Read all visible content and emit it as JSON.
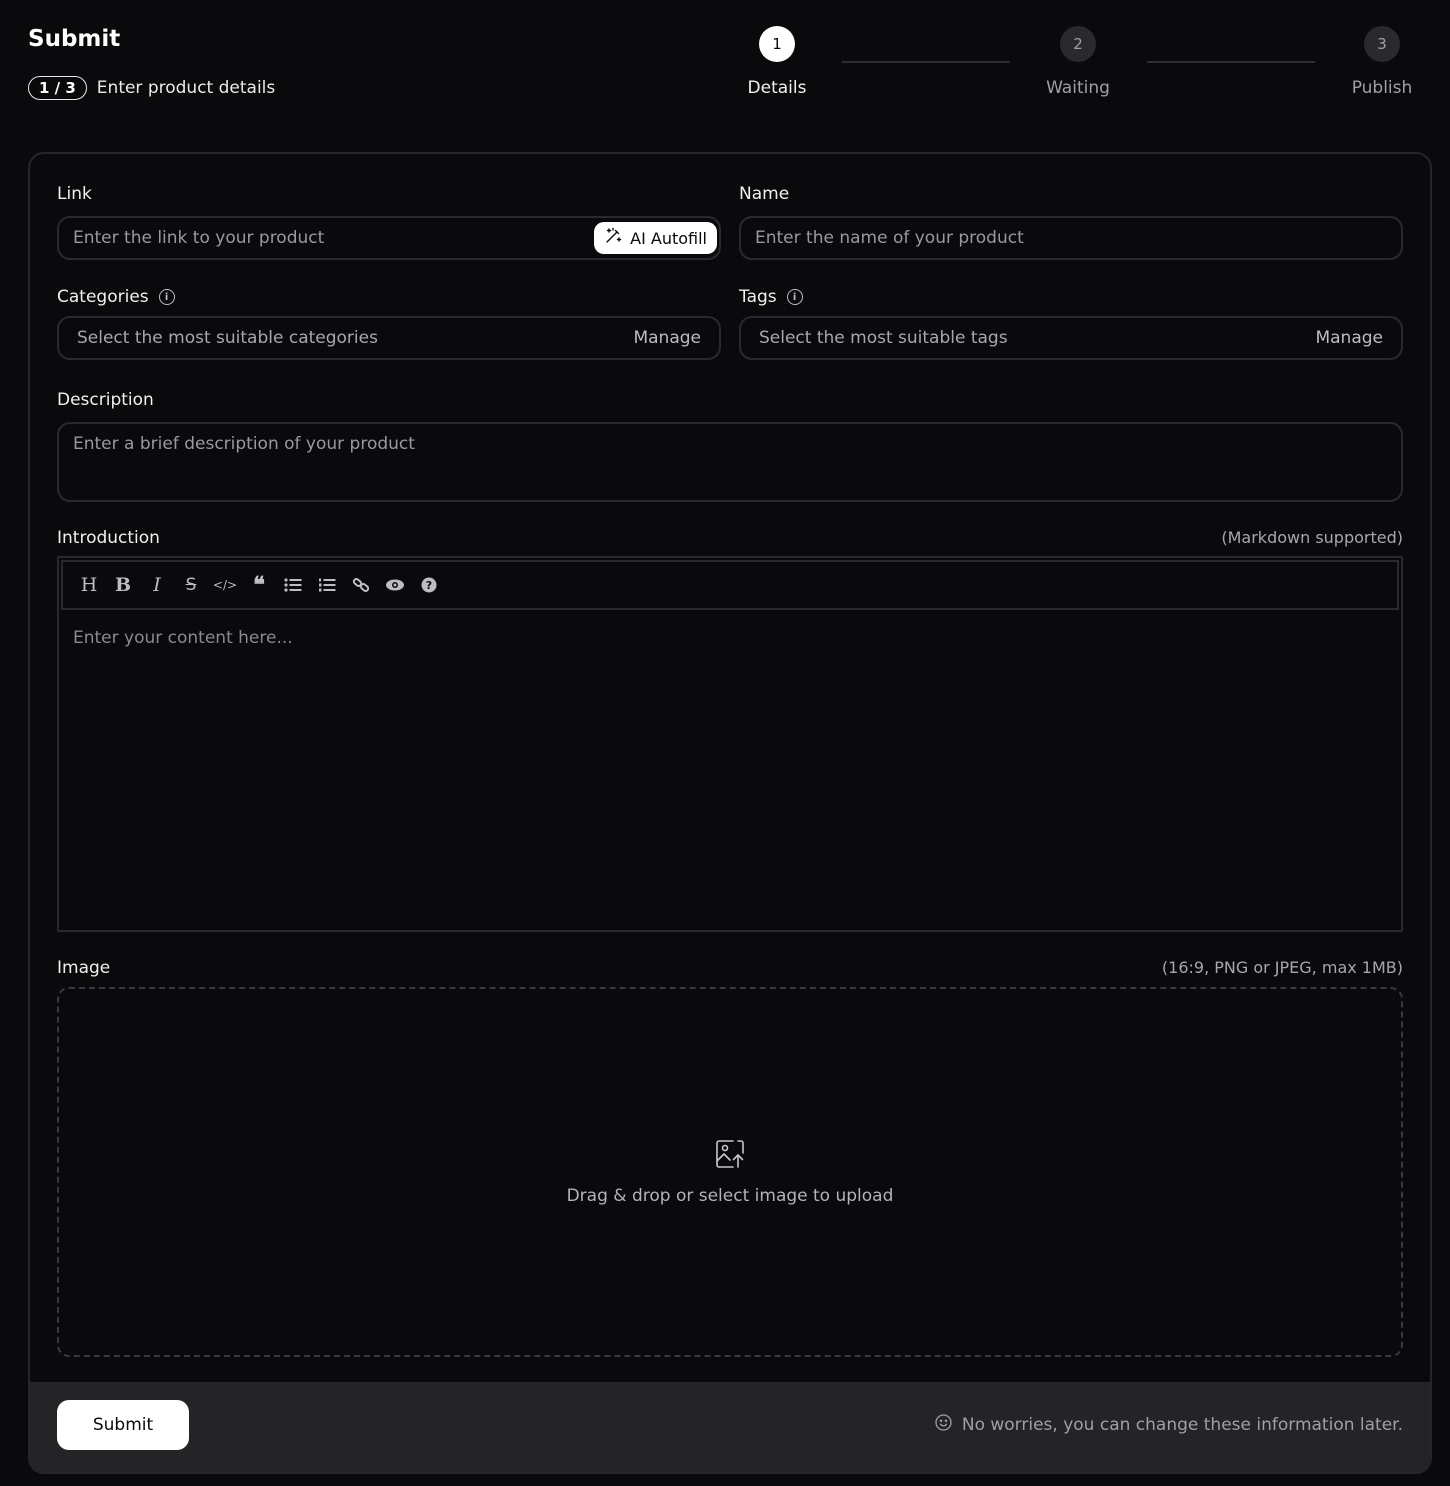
{
  "header": {
    "title": "Submit",
    "step_badge": "1 / 3",
    "step_description": "Enter product details"
  },
  "stepper": {
    "steps": [
      {
        "number": "1",
        "label": "Details",
        "active": true
      },
      {
        "number": "2",
        "label": "Waiting",
        "active": false
      },
      {
        "number": "3",
        "label": "Publish",
        "active": false
      }
    ]
  },
  "form": {
    "link": {
      "label": "Link",
      "placeholder": "Enter the link to your product",
      "autofill_label": "AI Autofill"
    },
    "name": {
      "label": "Name",
      "placeholder": "Enter the name of your product"
    },
    "categories": {
      "label": "Categories",
      "placeholder": "Select the most suitable categories",
      "manage_label": "Manage"
    },
    "tags": {
      "label": "Tags",
      "placeholder": "Select the most suitable tags",
      "manage_label": "Manage"
    },
    "description": {
      "label": "Description",
      "placeholder": "Enter a brief description of your product"
    },
    "introduction": {
      "label": "Introduction",
      "hint": "(Markdown supported)",
      "placeholder": "Enter your content here...",
      "toolbar": [
        "heading-icon",
        "bold-icon",
        "italic-icon",
        "strikethrough-icon",
        "code-icon",
        "quote-icon",
        "unordered-list-icon",
        "ordered-list-icon",
        "link-icon",
        "preview-icon",
        "help-icon"
      ]
    },
    "image": {
      "label": "Image",
      "hint": "(16:9, PNG or JPEG, max 1MB)",
      "drop_text": "Drag & drop or select image to upload"
    }
  },
  "footer": {
    "submit_label": "Submit",
    "note": "No worries, you can change these information later."
  }
}
